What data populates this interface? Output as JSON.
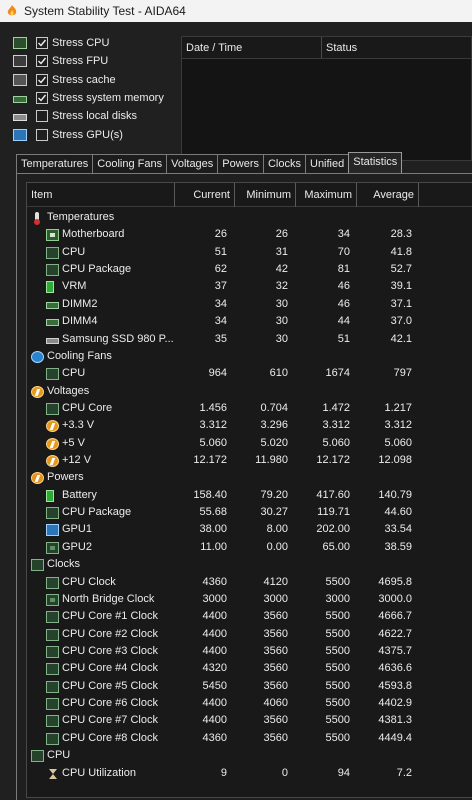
{
  "window": {
    "title": "System Stability Test - AIDA64"
  },
  "stress": [
    {
      "label": "Stress CPU",
      "checked": true,
      "icon": "cpu-chip-icon"
    },
    {
      "label": "Stress FPU",
      "checked": true,
      "icon": "fpu-icon"
    },
    {
      "label": "Stress cache",
      "checked": true,
      "icon": "cache-icon"
    },
    {
      "label": "Stress system memory",
      "checked": true,
      "icon": "memory-module-icon"
    },
    {
      "label": "Stress local disks",
      "checked": false,
      "icon": "disk-drive-icon"
    },
    {
      "label": "Stress GPU(s)",
      "checked": false,
      "icon": "gpu-icon"
    }
  ],
  "log": {
    "col_datetime": "Date / Time",
    "col_status": "Status"
  },
  "tabs": [
    "Temperatures",
    "Cooling Fans",
    "Voltages",
    "Powers",
    "Clocks",
    "Unified",
    "Statistics"
  ],
  "active_tab": "Statistics",
  "grid": {
    "headers": {
      "item": "Item",
      "current": "Current",
      "minimum": "Minimum",
      "maximum": "Maximum",
      "average": "Average"
    },
    "rows": [
      {
        "type": "group",
        "icon": "thermometer-icon",
        "name": "Temperatures"
      },
      {
        "type": "child",
        "icon": "motherboard-icon",
        "name": "Motherboard",
        "cur": "26",
        "min": "26",
        "max": "34",
        "avg": "28.3"
      },
      {
        "type": "child",
        "icon": "cpu-icon",
        "name": "CPU",
        "cur": "51",
        "min": "31",
        "max": "70",
        "avg": "41.8"
      },
      {
        "type": "child",
        "icon": "cpu-icon",
        "name": "CPU Package",
        "cur": "62",
        "min": "42",
        "max": "81",
        "avg": "52.7"
      },
      {
        "type": "child",
        "icon": "battery-icon",
        "name": "VRM",
        "cur": "37",
        "min": "32",
        "max": "46",
        "avg": "39.1"
      },
      {
        "type": "child",
        "icon": "memory-module-icon",
        "name": "DIMM2",
        "cur": "34",
        "min": "30",
        "max": "46",
        "avg": "37.1"
      },
      {
        "type": "child",
        "icon": "memory-module-icon",
        "name": "DIMM4",
        "cur": "34",
        "min": "30",
        "max": "44",
        "avg": "37.0"
      },
      {
        "type": "child",
        "icon": "ssd-icon",
        "name": "Samsung SSD 980 P...",
        "cur": "35",
        "min": "30",
        "max": "51",
        "avg": "42.1"
      },
      {
        "type": "group",
        "icon": "fan-icon",
        "name": "Cooling Fans"
      },
      {
        "type": "child",
        "icon": "cpu-icon",
        "name": "CPU",
        "cur": "964",
        "min": "610",
        "max": "1674",
        "avg": "797"
      },
      {
        "type": "group",
        "icon": "voltage-icon",
        "name": "Voltages"
      },
      {
        "type": "child",
        "icon": "cpu-icon",
        "name": "CPU Core",
        "cur": "1.456",
        "min": "0.704",
        "max": "1.472",
        "avg": "1.217"
      },
      {
        "type": "child",
        "icon": "voltage-icon",
        "name": "+3.3 V",
        "cur": "3.312",
        "min": "3.296",
        "max": "3.312",
        "avg": "3.312"
      },
      {
        "type": "child",
        "icon": "voltage-icon",
        "name": "+5 V",
        "cur": "5.060",
        "min": "5.020",
        "max": "5.060",
        "avg": "5.060"
      },
      {
        "type": "child",
        "icon": "voltage-icon",
        "name": "+12 V",
        "cur": "12.172",
        "min": "11.980",
        "max": "12.172",
        "avg": "12.098"
      },
      {
        "type": "group",
        "icon": "power-icon",
        "name": "Powers"
      },
      {
        "type": "child",
        "icon": "battery-icon",
        "name": "Battery",
        "cur": "158.40",
        "min": "79.20",
        "max": "417.60",
        "avg": "140.79"
      },
      {
        "type": "child",
        "icon": "cpu-icon",
        "name": "CPU Package",
        "cur": "55.68",
        "min": "30.27",
        "max": "119.71",
        "avg": "44.60"
      },
      {
        "type": "child",
        "icon": "gpu-icon",
        "name": "GPU1",
        "cur": "38.00",
        "min": "8.00",
        "max": "202.00",
        "avg": "33.54"
      },
      {
        "type": "child",
        "icon": "gpu-chip-icon",
        "name": "GPU2",
        "cur": "11.00",
        "min": "0.00",
        "max": "65.00",
        "avg": "38.59"
      },
      {
        "type": "group",
        "icon": "clock-icon",
        "name": "Clocks"
      },
      {
        "type": "child",
        "icon": "cpu-icon",
        "name": "CPU Clock",
        "cur": "4360",
        "min": "4120",
        "max": "5500",
        "avg": "4695.8"
      },
      {
        "type": "child",
        "icon": "chipset-icon",
        "name": "North Bridge Clock",
        "cur": "3000",
        "min": "3000",
        "max": "3000",
        "avg": "3000.0"
      },
      {
        "type": "child",
        "icon": "cpu-icon",
        "name": "CPU Core #1 Clock",
        "cur": "4400",
        "min": "3560",
        "max": "5500",
        "avg": "4666.7"
      },
      {
        "type": "child",
        "icon": "cpu-icon",
        "name": "CPU Core #2 Clock",
        "cur": "4400",
        "min": "3560",
        "max": "5500",
        "avg": "4622.7"
      },
      {
        "type": "child",
        "icon": "cpu-icon",
        "name": "CPU Core #3 Clock",
        "cur": "4400",
        "min": "3560",
        "max": "5500",
        "avg": "4375.7"
      },
      {
        "type": "child",
        "icon": "cpu-icon",
        "name": "CPU Core #4 Clock",
        "cur": "4320",
        "min": "3560",
        "max": "5500",
        "avg": "4636.6"
      },
      {
        "type": "child",
        "icon": "cpu-icon",
        "name": "CPU Core #5 Clock",
        "cur": "5450",
        "min": "3560",
        "max": "5500",
        "avg": "4593.8"
      },
      {
        "type": "child",
        "icon": "cpu-icon",
        "name": "CPU Core #6 Clock",
        "cur": "4400",
        "min": "4060",
        "max": "5500",
        "avg": "4402.9"
      },
      {
        "type": "child",
        "icon": "cpu-icon",
        "name": "CPU Core #7 Clock",
        "cur": "4400",
        "min": "3560",
        "max": "5500",
        "avg": "4381.3"
      },
      {
        "type": "child",
        "icon": "cpu-icon",
        "name": "CPU Core #8 Clock",
        "cur": "4360",
        "min": "3560",
        "max": "5500",
        "avg": "4449.4"
      },
      {
        "type": "group",
        "icon": "cpu-icon",
        "name": "CPU"
      },
      {
        "type": "child",
        "icon": "hourglass-icon",
        "name": "CPU Utilization",
        "cur": "9",
        "min": "0",
        "max": "94",
        "avg": "7.2"
      }
    ]
  }
}
